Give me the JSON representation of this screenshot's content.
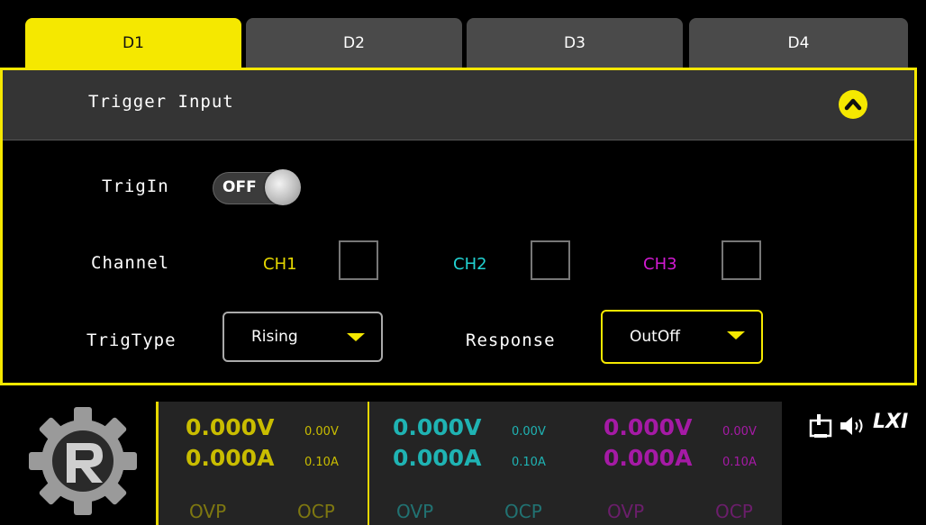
{
  "tabs": [
    {
      "label": "D1",
      "active": true
    },
    {
      "label": "D2",
      "active": false
    },
    {
      "label": "D3",
      "active": false
    },
    {
      "label": "D4",
      "active": false
    }
  ],
  "panel": {
    "title": "Trigger Input",
    "collapse_icon": "chevron-up-icon",
    "trigin_label": "TrigIn",
    "trigin_state": "OFF",
    "channel_label": "Channel",
    "channels": [
      {
        "label": "CH1",
        "color": "#e6d800",
        "checked": false
      },
      {
        "label": "CH2",
        "color": "#22d3d3",
        "checked": false
      },
      {
        "label": "CH3",
        "color": "#d21ad2",
        "checked": false
      }
    ],
    "trigtype_label": "TrigType",
    "trigtype_value": "Rising",
    "response_label": "Response",
    "response_value": "OutOff"
  },
  "bottom": {
    "channels": [
      {
        "voltage": "0.000V",
        "current": "0.000A",
        "set_voltage": "0.00V",
        "set_current": "0.10A",
        "ovp": "OVP",
        "ocp": "OCP",
        "color": "#c9bd00"
      },
      {
        "voltage": "0.000V",
        "current": "0.000A",
        "set_voltage": "0.00V",
        "set_current": "0.10A",
        "ovp": "OVP",
        "ocp": "OCP",
        "color": "#1fb3b3"
      },
      {
        "voltage": "0.000V",
        "current": "0.000A",
        "set_voltage": "0.00V",
        "set_current": "0.10A",
        "ovp": "OVP",
        "ocp": "OCP",
        "color": "#a51aa5"
      }
    ],
    "status_icons": [
      "usb-device-icon",
      "speaker-icon"
    ],
    "lxi_label": "LXI"
  },
  "colors": {
    "accent": "#f5e800",
    "tab_inactive": "#4a4a4a",
    "header_bg": "#343434"
  }
}
